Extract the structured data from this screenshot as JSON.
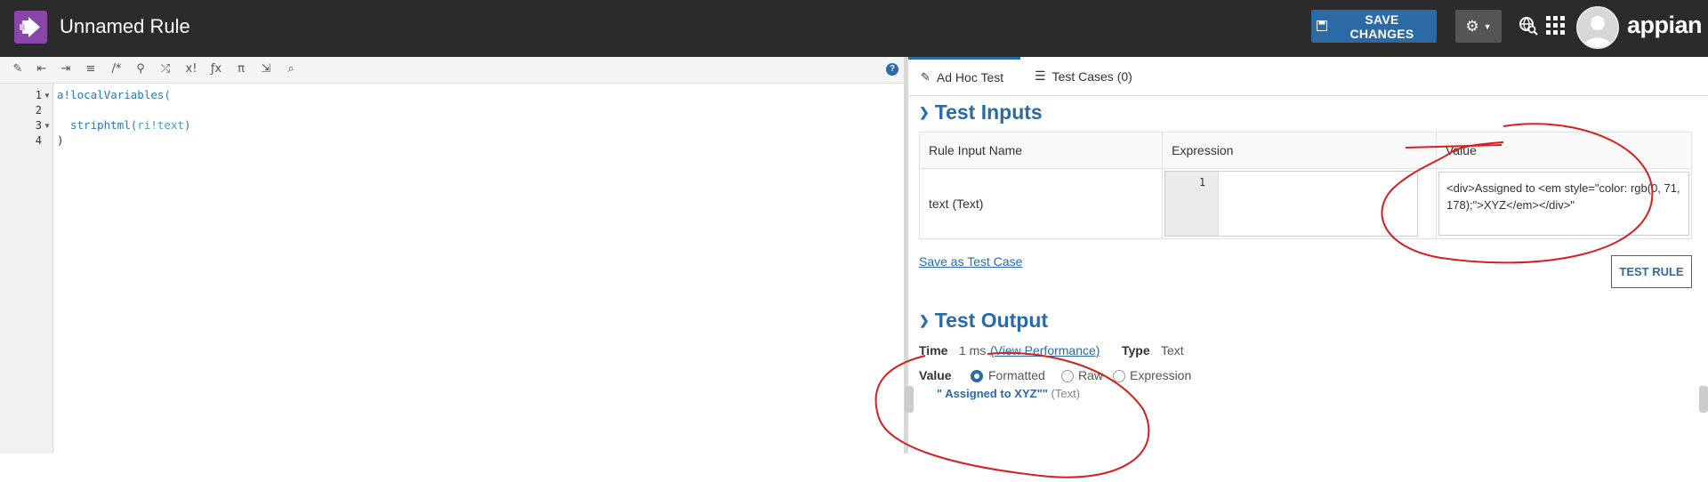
{
  "header": {
    "title": "Unnamed Rule",
    "save_label": "SAVE CHANGES",
    "brand": "appian"
  },
  "editor": {
    "line_numbers": [
      "1",
      "2",
      "3",
      "4"
    ],
    "code": {
      "l1": "a!localVariables(",
      "l3_fn": "striphtml(",
      "l3_arg": "ri!text",
      "l3_close": ")",
      "l4": ")"
    }
  },
  "tabs": [
    {
      "label": "Ad Hoc Test"
    },
    {
      "label": "Test Cases (0)"
    }
  ],
  "test_inputs": {
    "title": "Test Inputs",
    "columns": [
      "Rule Input Name",
      "Expression",
      "Value"
    ],
    "row": {
      "name": "text (Text)",
      "expr_line": "1",
      "value": "<div>Assigned to <em style=\"color: rgb(0, 71, 178);\">XYZ</em></div>\""
    },
    "save_link": "Save as Test Case",
    "test_button": "TEST RULE"
  },
  "test_output": {
    "title": "Test Output",
    "time_label": "Time",
    "time_value": "1 ms",
    "view_perf": "(View Performance)",
    "type_label": "Type",
    "type_value": "Text",
    "value_label": "Value",
    "radios": [
      {
        "label": "Formatted",
        "selected": true
      },
      {
        "label": "Raw",
        "selected": false
      },
      {
        "label": "Expression",
        "selected": false
      }
    ],
    "result": "\" Assigned to XYZ\"\"",
    "result_type": "(Text)"
  },
  "colors": {
    "accent": "#2c6aa6",
    "header_bg": "#2b2b2b",
    "annotation": "#d42020"
  }
}
